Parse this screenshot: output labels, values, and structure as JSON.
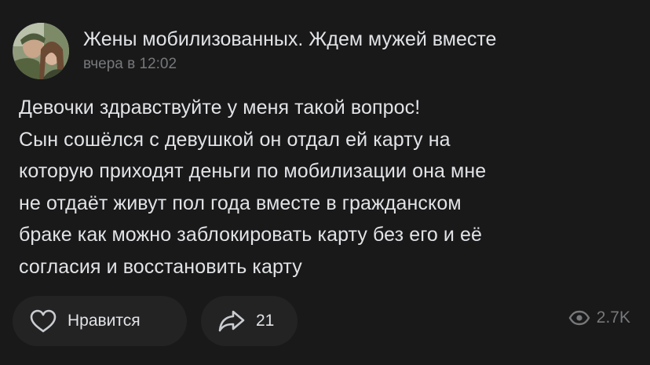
{
  "header": {
    "group_name": "Жены мобилизованных. Ждем мужей вместе",
    "time": "вчера в 12:02",
    "avatar_icon": "group-avatar-photo"
  },
  "post": {
    "lines": [
      "Девочки здравствуйте у меня такой вопрос!",
      "Сын сошёлся с девушкой он отдал ей карту на",
      "которую приходят деньги по мобилизации она мне",
      "не отдаёт живут пол года вместе в гражданском",
      "браке как можно заблокировать карту без его и её",
      "согласия и восстановить карту"
    ]
  },
  "actions": {
    "like_label": "Нравится",
    "like_icon": "heart-icon",
    "share_count": "21",
    "share_icon": "share-arrow-icon"
  },
  "views": {
    "count": "2.7K",
    "icon": "eye-icon"
  },
  "colors": {
    "background": "#19191a",
    "pill": "#232324",
    "text_primary": "#e1e3e6",
    "text_secondary": "#76787a"
  }
}
